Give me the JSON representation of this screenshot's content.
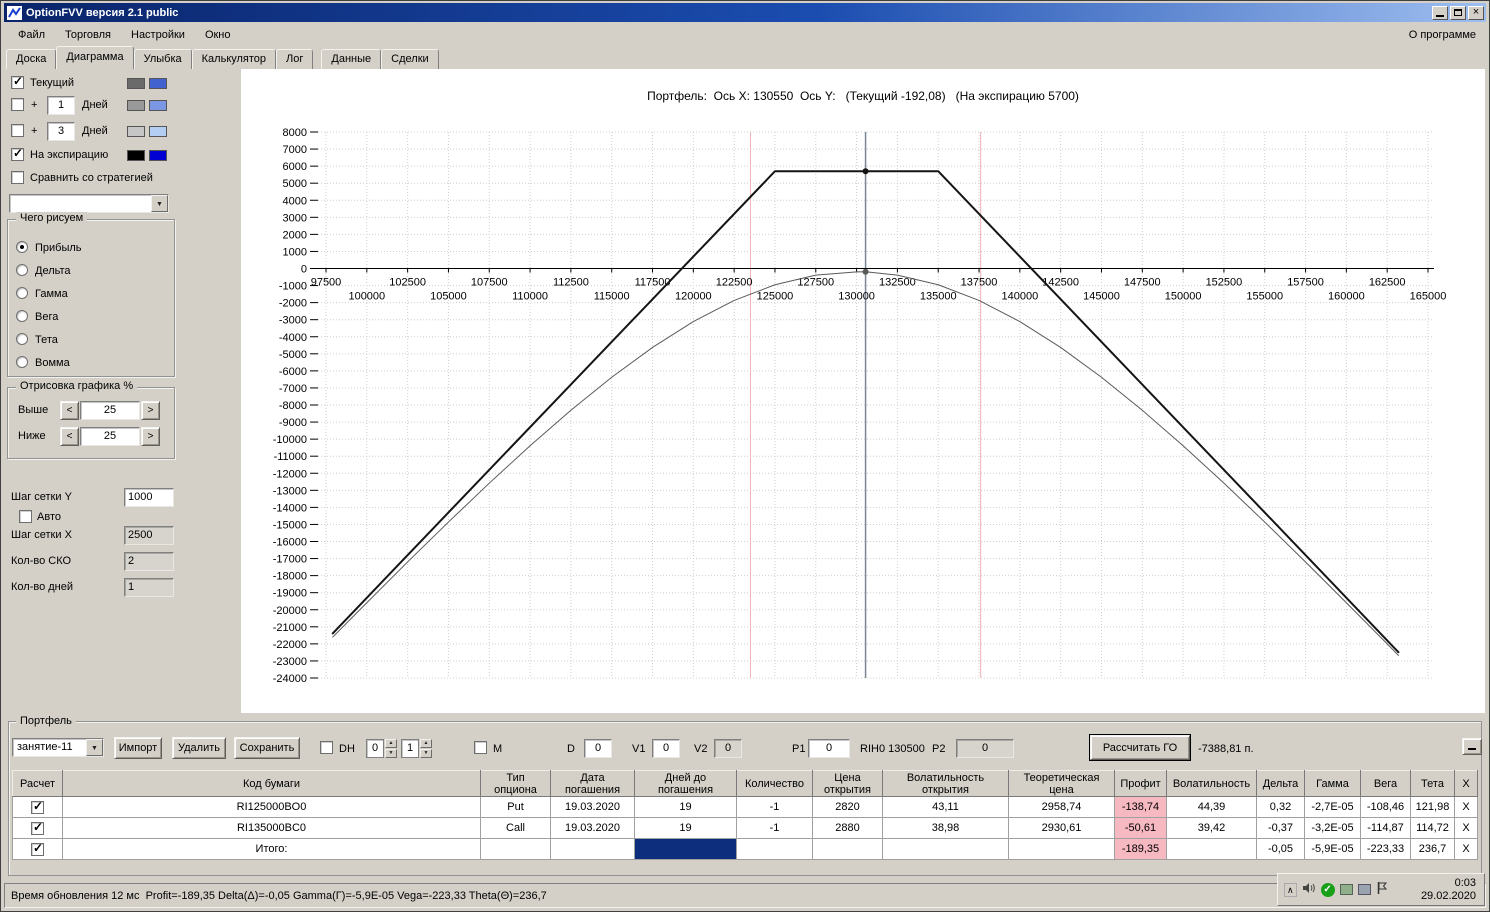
{
  "window": {
    "title": "OptionFVV версия 2.1 public"
  },
  "menu": {
    "items": [
      "Файл",
      "Торговля",
      "Настройки",
      "Окно"
    ],
    "about": "О программе"
  },
  "tabs": {
    "items": [
      "Доска",
      "Диаграмма",
      "Улыбка",
      "Калькулятор",
      "Лог",
      "Данные",
      "Сделки"
    ],
    "active": "Диаграмма"
  },
  "left_panel": {
    "current_label": "Текущий",
    "plus1": {
      "prefix": "+",
      "days": "1",
      "suffix": "Дней"
    },
    "plus2": {
      "prefix": "+",
      "days": "3",
      "suffix": "Дней"
    },
    "expiration_label": "На экспирацию",
    "compare_label": "Сравнить со стратегией",
    "strategy_value": "",
    "draw_group": {
      "title": "Чего рисуем",
      "options": [
        "Прибыль",
        "Дельта",
        "Гамма",
        "Вега",
        "Тета",
        "Вомма"
      ],
      "selected": "Прибыль"
    },
    "range_group": {
      "title": "Отрисовка графика %",
      "above_label": "Выше",
      "above_value": "25",
      "below_label": "Ниже",
      "below_value": "25",
      "dec": "<",
      "inc": ">"
    },
    "grid_y_label": "Шаг сетки Y",
    "grid_y_value": "1000",
    "auto_label": "Авто",
    "grid_x_label": "Шаг сетки X",
    "grid_x_value": "2500",
    "sko_label": "Кол-во СКО",
    "sko_value": "2",
    "days_label": "Кол-во дней",
    "days_value": "1"
  },
  "colors": {
    "current_line1": "#6a6a6a",
    "current_line2": "#4263cf",
    "plus1_1": "#999999",
    "plus1_2": "#7b97e4",
    "plus2_1": "#c6c6c6",
    "plus2_2": "#b4cdf3",
    "expiration_1": "#000000",
    "expiration_2": "#0000d2"
  },
  "chart_data": {
    "type": "line",
    "title": "Портфель:  Ось X: 130550  Ось Y:   (Текущий -192,08)   (На экспирацию 5700)",
    "x_axis": {
      "min": 97500,
      "max": 165000,
      "step": 2500
    },
    "y_axis": {
      "min": -24000,
      "max": 8000,
      "step": 1000
    },
    "grid": true,
    "cursor_x": 130550,
    "sko_lines": [
      123500,
      137600
    ],
    "series": [
      {
        "name": "Текущий",
        "color": "#5a5a5a",
        "width": 1,
        "points": [
          [
            97912,
            -21602
          ],
          [
            100000,
            -19588
          ],
          [
            102500,
            -17199
          ],
          [
            105000,
            -14861
          ],
          [
            107500,
            -12582
          ],
          [
            110000,
            -10390
          ],
          [
            112500,
            -8308
          ],
          [
            115000,
            -6374
          ],
          [
            117500,
            -4627
          ],
          [
            120000,
            -3111
          ],
          [
            122500,
            -1872
          ],
          [
            125000,
            -953
          ],
          [
            127500,
            -388
          ],
          [
            130000,
            -196
          ],
          [
            130550,
            -192
          ],
          [
            132500,
            -388
          ],
          [
            135000,
            -953
          ],
          [
            137500,
            -1872
          ],
          [
            140000,
            -3111
          ],
          [
            142500,
            -4627
          ],
          [
            145000,
            -6374
          ],
          [
            147500,
            -8308
          ],
          [
            150000,
            -10390
          ],
          [
            152500,
            -12582
          ],
          [
            155000,
            -14861
          ],
          [
            157500,
            -17199
          ],
          [
            160000,
            -19588
          ],
          [
            162500,
            -22002
          ],
          [
            163188,
            -22672
          ]
        ]
      },
      {
        "name": "На экспирацию",
        "color": "#141414",
        "width": 2,
        "points": [
          [
            97912,
            -21388
          ],
          [
            125000,
            5700
          ],
          [
            135000,
            5700
          ],
          [
            163188,
            -22488
          ]
        ]
      }
    ],
    "markers": [
      {
        "x": 130550,
        "y": 5700,
        "color": "#141414"
      },
      {
        "x": 130550,
        "y": -192,
        "color": "#5a5a5a"
      }
    ]
  },
  "portfolio": {
    "group_label": "Портфель",
    "preset_value": "занятие-11",
    "import_label": "Импорт",
    "delete_label": "Удалить",
    "save_label": "Сохранить",
    "dh_label": "DH",
    "spin1_value": "0",
    "spin2_value": "1",
    "m_label": "M",
    "d_label": "D",
    "d_value": "0",
    "v1_label": "V1",
    "v1_value": "0",
    "v2_label": "V2",
    "v2_value": "0",
    "p1_label": "P1",
    "p1_value": "0",
    "ticker_label": "RIH0 130500",
    "p2_label": "P2",
    "p2_value": "0",
    "calc_go_label": "Рассчитать ГО",
    "go_value": "-7388,81 п."
  },
  "table": {
    "headers": [
      "Расчет",
      "Код бумаги",
      "Тип\nопциона",
      "Дата\nпогашения",
      "Дней до\nпогашения",
      "Количество",
      "Цена\nоткрытия",
      "Волатильность\nоткрытия",
      "Теоретическая\nцена",
      "Профит",
      "Волатильность",
      "Дельта",
      "Гамма",
      "Вега",
      "Тета",
      "X"
    ],
    "close_label": "X",
    "rows": [
      {
        "checked": true,
        "code": "RI125000BO0",
        "type": "Put",
        "maturity": "19.03.2020",
        "days": "19",
        "qty": "-1",
        "open_price": "2820",
        "open_vol": "43,11",
        "theor_price": "2958,74",
        "profit": "-138,74",
        "vol": "44,39",
        "delta": "0,32",
        "gamma": "-2,7E-05",
        "vega": "-108,46",
        "theta": "121,98"
      },
      {
        "checked": true,
        "code": "RI135000BC0",
        "type": "Call",
        "maturity": "19.03.2020",
        "days": "19",
        "qty": "-1",
        "open_price": "2880",
        "open_vol": "38,98",
        "theor_price": "2930,61",
        "profit": "-50,61",
        "vol": "39,42",
        "delta": "-0,37",
        "gamma": "-3,2E-05",
        "vega": "-114,87",
        "theta": "114,72"
      },
      {
        "checked": true,
        "code": "Итого:",
        "type": "",
        "maturity": "",
        "days": "",
        "days_selected": true,
        "qty": "",
        "open_price": "",
        "open_vol": "",
        "theor_price": "",
        "profit": "-189,35",
        "vol": "",
        "delta": "-0,05",
        "gamma": "-5,9E-05",
        "vega": "-223,33",
        "theta": "236,7"
      }
    ]
  },
  "status_bar": {
    "text": "Время обновления 12 мс  Profit=-189,35 Delta(Δ)=-0,05 Gamma(Γ)=-5,9E-05 Vega=-223,33 Theta(Θ)=236,7"
  },
  "tray": {
    "time": "0:03",
    "date": "29.02.2020"
  }
}
